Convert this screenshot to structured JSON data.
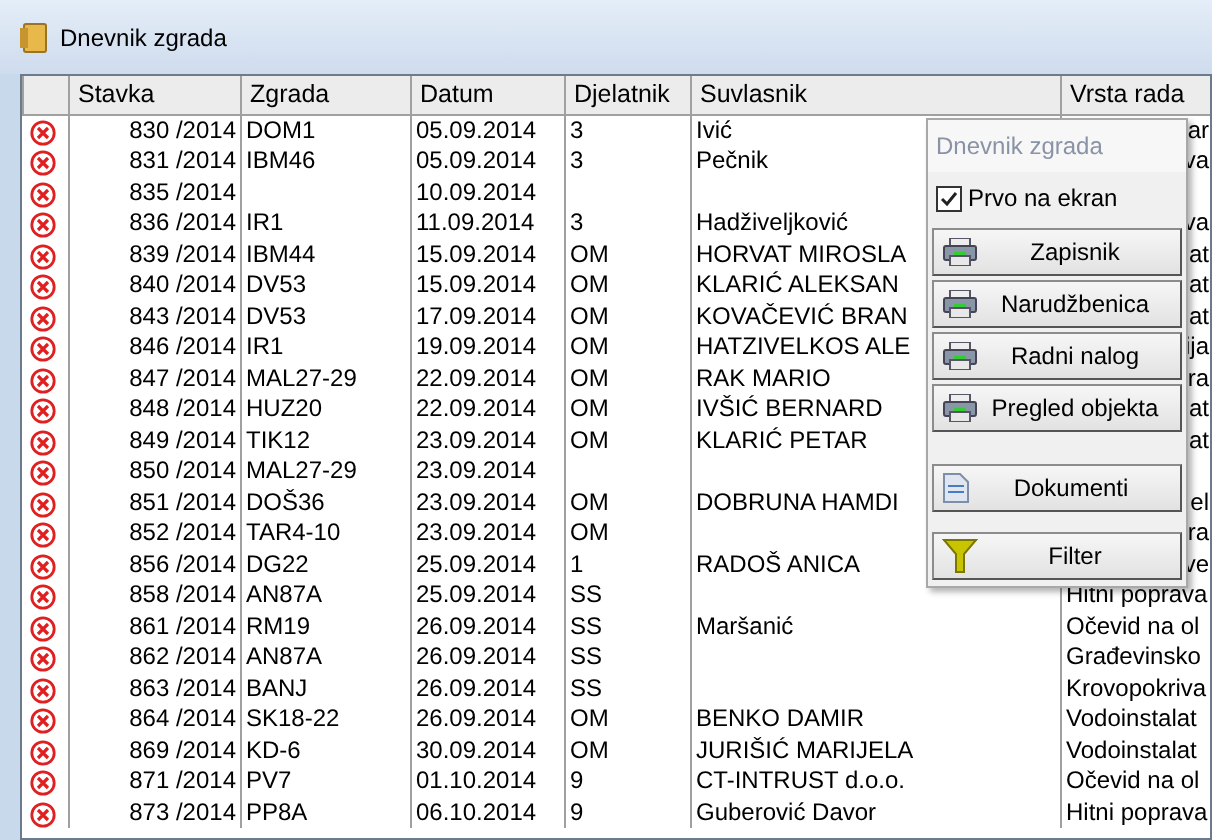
{
  "window": {
    "title": "Dnevnik zgrada"
  },
  "table": {
    "columns": [
      "Stavka",
      "Zgrada",
      "Datum",
      "Djelatnik",
      "Suvlasnik",
      "Vrsta rada"
    ],
    "rows": [
      {
        "stavka": "830 /2014",
        "zgrada": "DOM1",
        "datum": "05.09.2014",
        "djelatnik": "3",
        "suvlasnik": "Ivić",
        "vrsta_rada": "ar",
        "covered": true
      },
      {
        "stavka": "831 /2014",
        "zgrada": "IBM46",
        "datum": "05.09.2014",
        "djelatnik": "3",
        "suvlasnik": "Pečnik",
        "vrsta_rada": "va",
        "covered": true
      },
      {
        "stavka": "835 /2014",
        "zgrada": "",
        "datum": "10.09.2014",
        "djelatnik": "",
        "suvlasnik": "",
        "vrsta_rada": ""
      },
      {
        "stavka": "836 /2014",
        "zgrada": "IR1",
        "datum": "11.09.2014",
        "djelatnik": "3",
        "suvlasnik": "Hadživeljković",
        "vrsta_rada": "va",
        "covered": true
      },
      {
        "stavka": "839 /2014",
        "zgrada": "IBM44",
        "datum": "15.09.2014",
        "djelatnik": "OM",
        "suvlasnik": "HORVAT MIROSLA",
        "vrsta_rada": "at",
        "covered": true
      },
      {
        "stavka": "840 /2014",
        "zgrada": "DV53",
        "datum": "15.09.2014",
        "djelatnik": "OM",
        "suvlasnik": "KLARIĆ  ALEKSAN",
        "vrsta_rada": "at",
        "covered": true
      },
      {
        "stavka": "843 /2014",
        "zgrada": "DV53",
        "datum": "17.09.2014",
        "djelatnik": "OM",
        "suvlasnik": "KOVAČEVIĆ BRAN",
        "vrsta_rada": "at",
        "covered": true
      },
      {
        "stavka": "846 /2014",
        "zgrada": "IR1",
        "datum": "19.09.2014",
        "djelatnik": "OM",
        "suvlasnik": "HATZIVELKOS ALE",
        "vrsta_rada": "ija",
        "covered": true
      },
      {
        "stavka": "847 /2014",
        "zgrada": "MAL27-29",
        "datum": "22.09.2014",
        "djelatnik": "OM",
        "suvlasnik": "RAK MARIO",
        "vrsta_rada": "ra",
        "covered": true
      },
      {
        "stavka": "848 /2014",
        "zgrada": "HUZ20",
        "datum": "22.09.2014",
        "djelatnik": "OM",
        "suvlasnik": "IVŠIĆ BERNARD",
        "vrsta_rada": "at",
        "covered": true
      },
      {
        "stavka": "849 /2014",
        "zgrada": "TIK12",
        "datum": "23.09.2014",
        "djelatnik": "OM",
        "suvlasnik": "KLARIĆ PETAR",
        "vrsta_rada": "at",
        "covered": true
      },
      {
        "stavka": "850 /2014",
        "zgrada": "MAL27-29",
        "datum": "23.09.2014",
        "djelatnik": "",
        "suvlasnik": "",
        "vrsta_rada": ""
      },
      {
        "stavka": "851 /2014",
        "zgrada": "DOŠ36",
        "datum": "23.09.2014",
        "djelatnik": "OM",
        "suvlasnik": "DOBRUNA HAMDI",
        "vrsta_rada": "el",
        "covered": true
      },
      {
        "stavka": "852 /2014",
        "zgrada": "TAR4-10",
        "datum": "23.09.2014",
        "djelatnik": "OM",
        "suvlasnik": "",
        "vrsta_rada": "ra",
        "covered": true
      },
      {
        "stavka": "856 /2014",
        "zgrada": "DG22",
        "datum": "25.09.2014",
        "djelatnik": "1",
        "suvlasnik": "RADOŠ ANICA",
        "vrsta_rada": "ve",
        "covered": true
      },
      {
        "stavka": "858 /2014",
        "zgrada": "AN87A",
        "datum": "25.09.2014",
        "djelatnik": "SS",
        "suvlasnik": "",
        "vrsta_rada": "Hitni poprava"
      },
      {
        "stavka": "861 /2014",
        "zgrada": "RM19",
        "datum": "26.09.2014",
        "djelatnik": "SS",
        "suvlasnik": "Maršanić",
        "vrsta_rada": "Očevid na ol"
      },
      {
        "stavka": "862 /2014",
        "zgrada": "AN87A",
        "datum": "26.09.2014",
        "djelatnik": "SS",
        "suvlasnik": "",
        "vrsta_rada": "Građevinsko"
      },
      {
        "stavka": "863 /2014",
        "zgrada": "BANJ",
        "datum": "26.09.2014",
        "djelatnik": "SS",
        "suvlasnik": "",
        "vrsta_rada": "Krovopokriva"
      },
      {
        "stavka": "864 /2014",
        "zgrada": "SK18-22",
        "datum": "26.09.2014",
        "djelatnik": "OM",
        "suvlasnik": "BENKO DAMIR",
        "vrsta_rada": "Vodoinstalat"
      },
      {
        "stavka": "869 /2014",
        "zgrada": "KD-6",
        "datum": "30.09.2014",
        "djelatnik": "OM",
        "suvlasnik": "JURIŠIĆ MARIJELA",
        "vrsta_rada": "Vodoinstalat"
      },
      {
        "stavka": "871 /2014",
        "zgrada": "PV7",
        "datum": "01.10.2014",
        "djelatnik": "9",
        "suvlasnik": "CT-INTRUST d.o.o.",
        "vrsta_rada": "Očevid na ol"
      },
      {
        "stavka": "873 /2014",
        "zgrada": "PP8A",
        "datum": "06.10.2014",
        "djelatnik": "9",
        "suvlasnik": "Guberović Davor",
        "vrsta_rada": "Hitni poprava"
      }
    ]
  },
  "popup": {
    "title": "Dnevnik zgrada",
    "checkbox": {
      "label": "Prvo na ekran",
      "checked": true
    },
    "buttons": [
      {
        "label": "Zapisnik",
        "kind": "print"
      },
      {
        "label": "Narudžbenica",
        "kind": "print"
      },
      {
        "label": "Radni nalog",
        "kind": "print"
      },
      {
        "label": "Pregled objekta",
        "kind": "print"
      },
      {
        "label": "Dokumenti",
        "kind": "document"
      },
      {
        "label": "Filter",
        "kind": "filter"
      }
    ]
  }
}
